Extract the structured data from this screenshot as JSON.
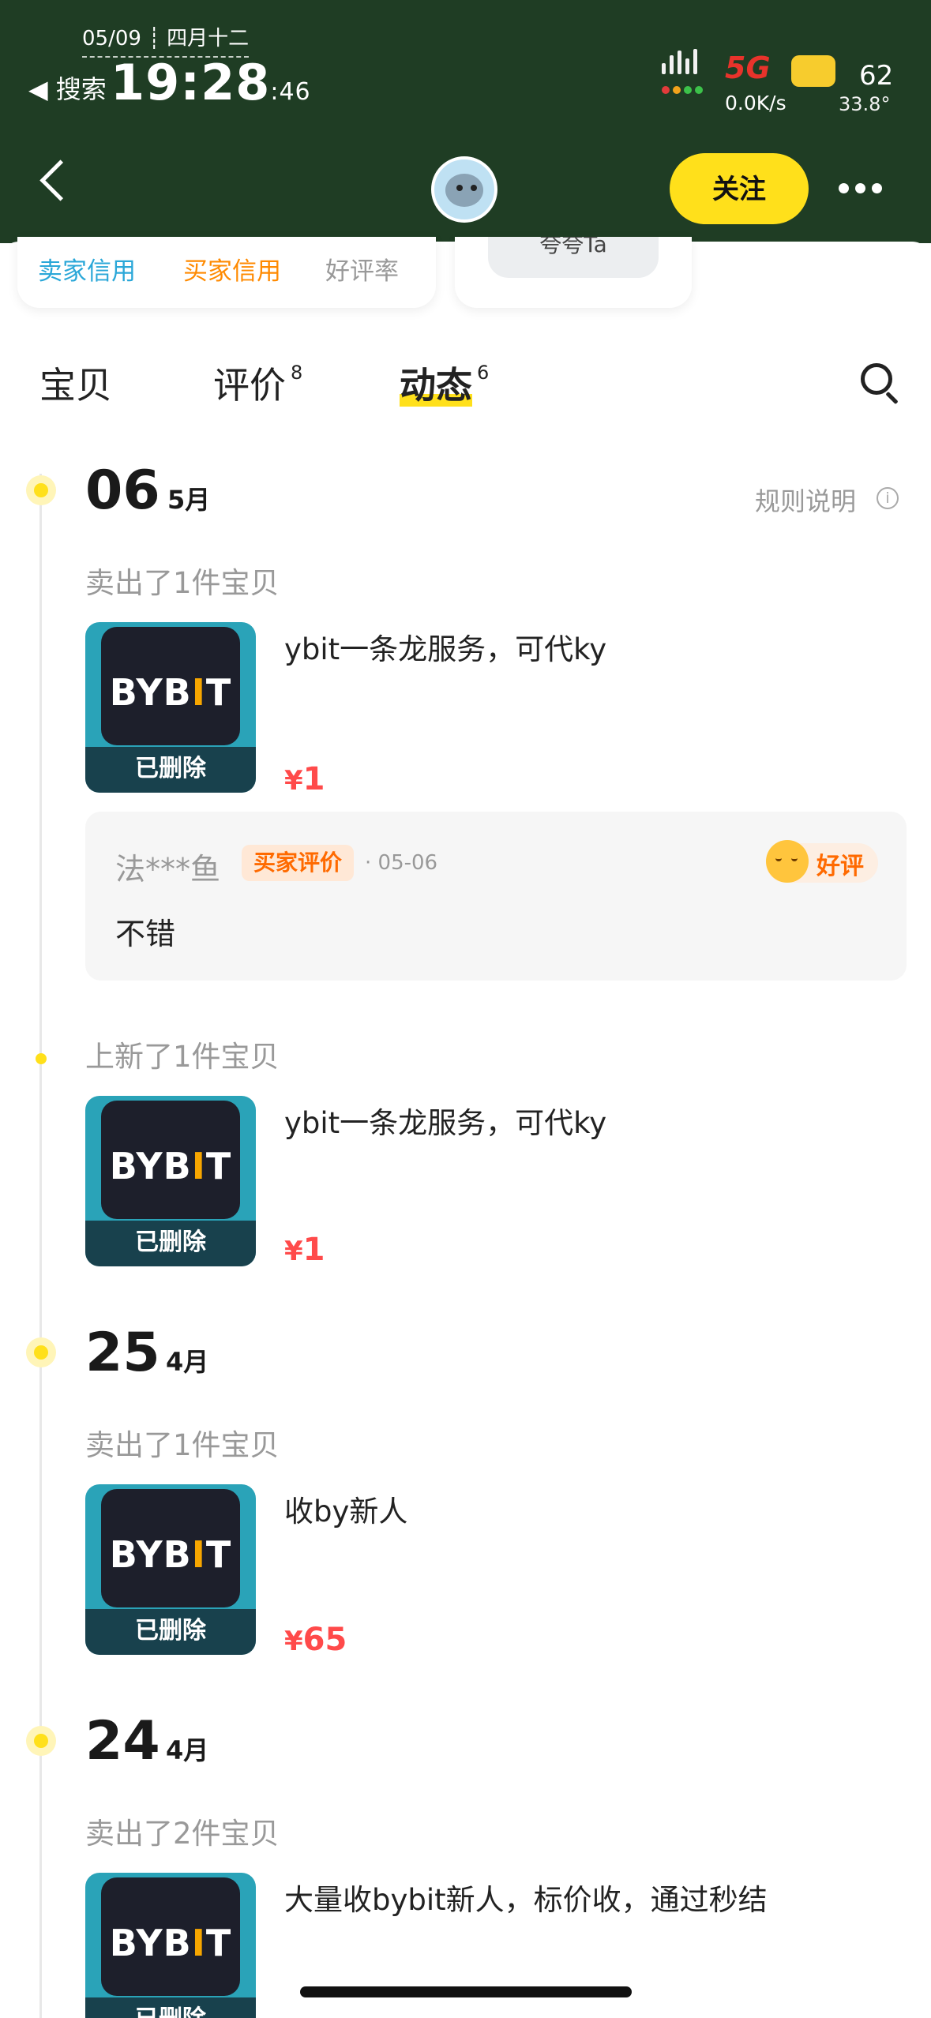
{
  "status_bar": {
    "date": "05/09 ┊ 四月十二",
    "back_app": "◀ 搜索",
    "time": "19:28",
    "seconds": ":46",
    "network": "5G",
    "speed": "0.0K/s",
    "battery": "62",
    "temperature": "33.8°"
  },
  "header": {
    "follow_label": "关注",
    "more_icon": "more-dots-icon",
    "back_icon": "chevron-left-icon"
  },
  "profile_cards": {
    "seller_credit": "卖家信用",
    "buyer_credit": "买家信用",
    "positive_rate": "好评率",
    "nickname_pill": "夸夸Ta"
  },
  "tabs": [
    {
      "label": "宝贝",
      "count": ""
    },
    {
      "label": "评价",
      "count": "8"
    },
    {
      "label": "动态",
      "count": "6"
    }
  ],
  "rule_link": "规则说明",
  "feed": {
    "g1": {
      "day": "06",
      "month": "5月",
      "action": "卖出了1件宝贝",
      "item": {
        "title": "ybit一条龙服务，可代ky",
        "price_symbol": "¥",
        "price": "1",
        "deleted": "已删除",
        "logo": "BYBIT"
      },
      "review": {
        "user": "法***鱼",
        "badge": "买家评价",
        "date": "· 05-06",
        "rating": "好评",
        "text": "不错"
      }
    },
    "g2": {
      "action": "上新了1件宝贝",
      "item": {
        "title": "ybit一条龙服务，可代ky",
        "price_symbol": "¥",
        "price": "1",
        "deleted": "已删除",
        "logo": "BYBIT"
      }
    },
    "g3": {
      "day": "25",
      "month": "4月",
      "action": "卖出了1件宝贝",
      "item": {
        "title": "收by新人",
        "price_symbol": "¥",
        "price": "65",
        "deleted": "已删除",
        "logo": "BYBIT"
      }
    },
    "g4": {
      "day": "24",
      "month": "4月",
      "action": "卖出了2件宝贝",
      "item": {
        "title": "大量收bybit新人，标价收，通过秒结",
        "deleted": "已删除",
        "logo": "BYBIT"
      }
    }
  },
  "colors": {
    "status_bg": "#1f3d24",
    "accent_yellow": "#ffe01b",
    "price_red": "#ff4a4a",
    "seller_blue": "#2aa7d8",
    "buyer_orange": "#ff8a00"
  }
}
